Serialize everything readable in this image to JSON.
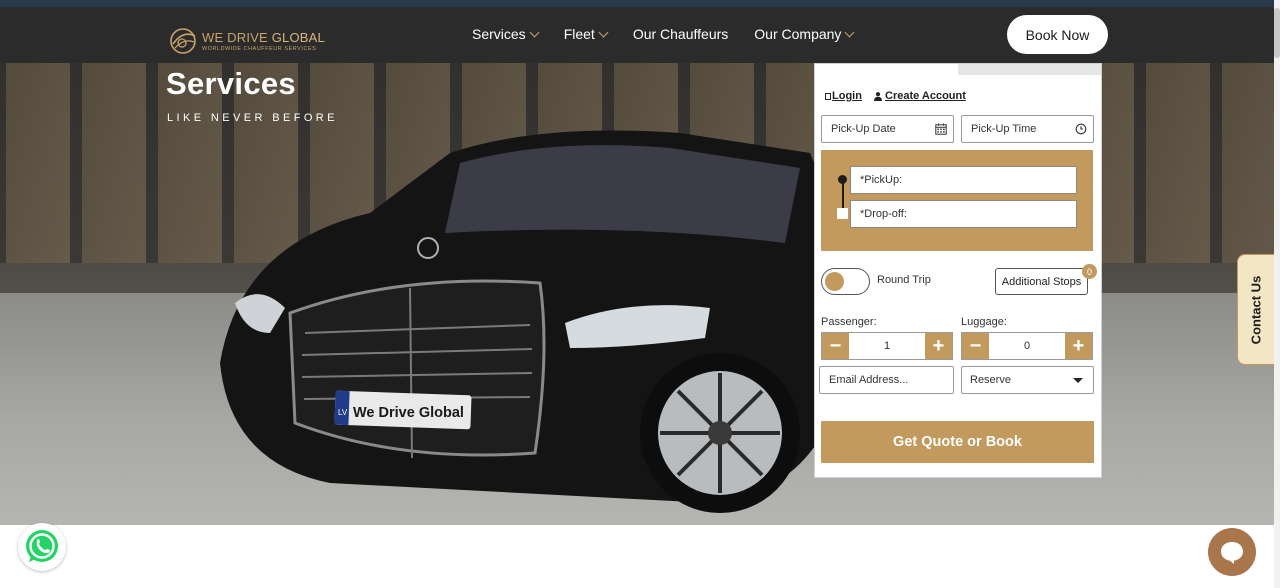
{
  "brand": {
    "name_part1": "WE DRIVE",
    "name_part2": "GLOBAL",
    "tagline": "WORLDWIDE CHAUFFEUR SERVICES",
    "accent_color": "#c29a5d",
    "nav_bg": "#2b2b2b"
  },
  "nav": {
    "items": [
      {
        "label": "Services",
        "has_dropdown": true
      },
      {
        "label": "Fleet",
        "has_dropdown": true
      },
      {
        "label": "Our Chauffeurs",
        "has_dropdown": false
      },
      {
        "label": "Our Company",
        "has_dropdown": true
      }
    ],
    "book_now": "Book Now"
  },
  "hero": {
    "title": "Services",
    "subtitle": "LIKE NEVER BEFORE",
    "plate_text": "We Drive Global",
    "plate_country": "LV"
  },
  "booking": {
    "login_label": "Login",
    "create_account_label": "Create Account",
    "pickup_date_placeholder": "Pick-Up Date",
    "pickup_time_placeholder": "Pick-Up Time",
    "pickup_placeholder": "*PickUp:",
    "dropoff_placeholder": "*Drop-off:",
    "round_trip_label": "Round Trip",
    "additional_stops_label": "Additional Stops",
    "additional_stops_count": "0",
    "passenger_label": "Passenger:",
    "passenger_value": "1",
    "luggage_label": "Luggage:",
    "luggage_value": "0",
    "minus_symbol": "−",
    "plus_symbol": "+",
    "email_placeholder": "Email Address...",
    "reserve_value": "Reserve",
    "submit_label": "Get Quote or Book"
  },
  "contact_tab": {
    "label": "Contact Us"
  },
  "floating": {
    "whatsapp_icon": "whatsapp-icon",
    "chat_icon": "chat-bubble-icon"
  }
}
